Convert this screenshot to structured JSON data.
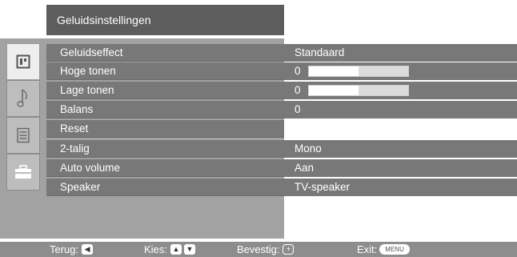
{
  "header": {
    "title": "Geluidsinstellingen"
  },
  "sidebar": {
    "tabs": [
      {
        "icon": "picture-icon",
        "active": true
      },
      {
        "icon": "music-note-icon",
        "active": false
      },
      {
        "icon": "channel-list-icon",
        "active": false
      },
      {
        "icon": "toolbox-icon",
        "active": false
      }
    ]
  },
  "settings": [
    {
      "label": "Geluidseffect",
      "value": "Standaard"
    },
    {
      "label": "Hoge tonen",
      "value": "0",
      "level": 0.5
    },
    {
      "label": "Lage tonen",
      "value": "0",
      "level": 0.5
    },
    {
      "label": "Balans",
      "value": "0"
    },
    {
      "label": "Reset",
      "value": ""
    },
    {
      "label": "2-talig",
      "value": "Mono"
    },
    {
      "label": "Auto volume",
      "value": "Aan"
    },
    {
      "label": "Speaker",
      "value": "TV-speaker"
    }
  ],
  "footer": {
    "back_label": "Terug:",
    "select_label": "Kies:",
    "confirm_label": "Bevestig:",
    "exit_label": "Exit:",
    "menu_key": "MENU"
  },
  "colors": {
    "row_bg": "#787878",
    "panel_bg": "#a2a2a2",
    "header_bg": "#5d5d5d",
    "footer_bg": "#8d8d8d"
  }
}
